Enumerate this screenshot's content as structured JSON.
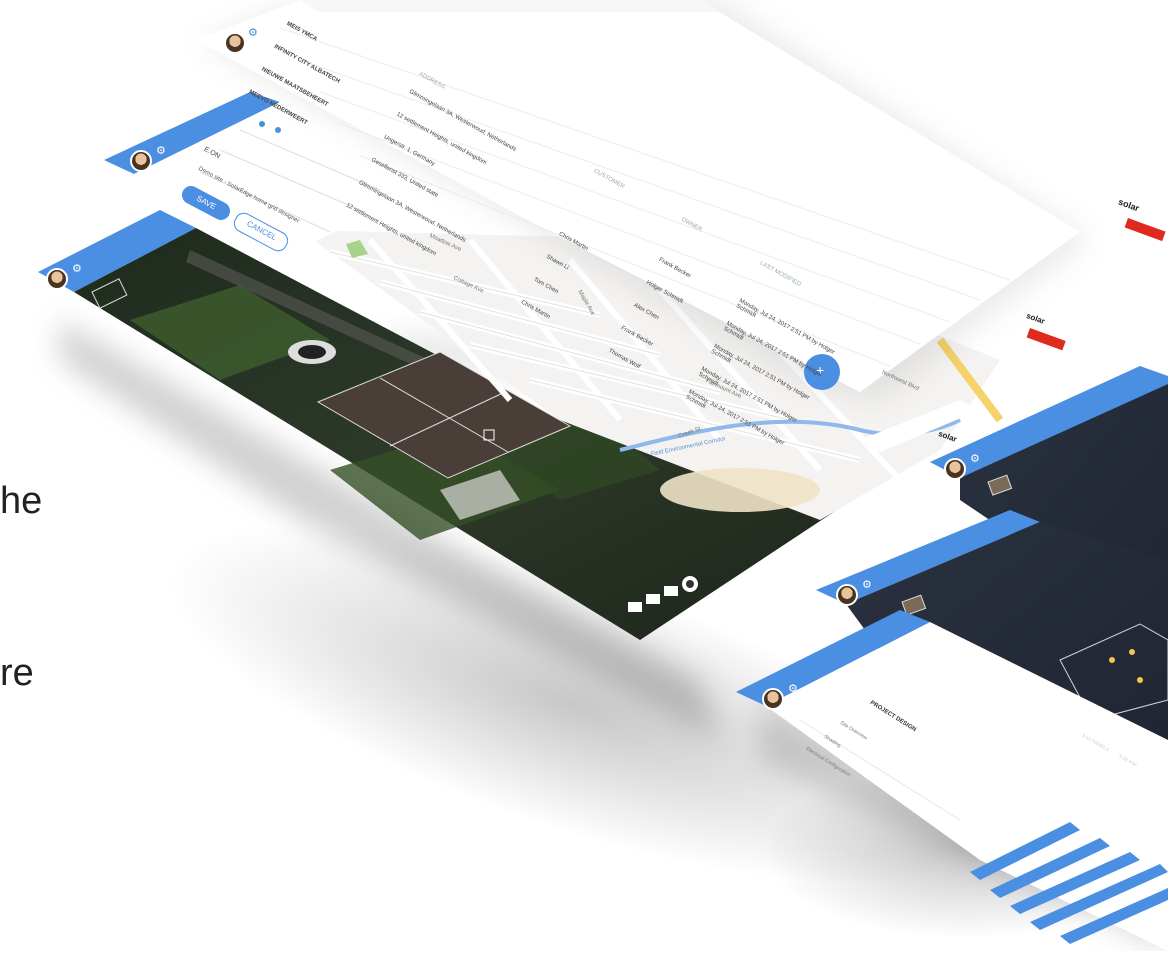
{
  "left_text": [
    "he",
    "re"
  ],
  "brand": {
    "name": "solar",
    "accent": "#e02a20",
    "blue": "#4a8fe2"
  },
  "table_screen": {
    "headers": [
      "",
      "ADDRESS",
      "CUSTOMER",
      "OWNER",
      "LAST MODIFIED"
    ],
    "rows": [
      {
        "name": "MEIS YMCA",
        "address": "Glimmingelaan 3A, Westerwoud, Netherlands",
        "customer": "",
        "owner": "",
        "modified": ""
      },
      {
        "name": "INFINITY CITY ALBATECH",
        "address": "12 settlement Heights, united kingdom",
        "customer": "",
        "owner": "Frank Becker",
        "modified": "Monday, Jul 24, 2017 2:51 PM by Holger Schmidt"
      },
      {
        "name": "NIEUWE MAATSBEHEERT",
        "address": "Ungerstr. 1, Germany",
        "customer": "Chris Martin",
        "owner": "Holger Schmidt",
        "modified": "Monday, Jul 24, 2017 2:51 PM by Holger Schmidt"
      },
      {
        "name": "MEEVO NEDERWEERT",
        "address": "Gesellenst 333, United state",
        "customer": "Shawn Li",
        "owner": "Alex Chen",
        "modified": "Monday, Jul 24, 2017 2:51 PM by Holger Schmidt"
      },
      {
        "name": "",
        "address": "Glimmingelaan 3A, Westerwoud, Netherlands",
        "customer": "Tom Chen",
        "owner": "Frank Becker",
        "modified": "Monday, Jul 24, 2017 2:51 PM by Holger Schmidt"
      },
      {
        "name": "",
        "address": "12 settlement Heights, united kingdom",
        "customer": "Chris Martin",
        "owner": "Thomas Wolf",
        "modified": "Monday, Jul 24, 2017 2:51 PM by Holger Schmidt"
      }
    ],
    "fab": "+"
  },
  "form_panel": {
    "utility_label": "E.ON",
    "tariff_label": "Demo site - SolarEdge home grid designer",
    "save_button": "SAVE",
    "cancel_button": "CANCEL"
  },
  "map": {
    "streets": [
      "Meadow Ave",
      "Cottage Ave",
      "Maple Ave",
      "Creek St",
      "Fairmount Ave",
      "Northwest Blvd"
    ],
    "trail": "Field Environmental Corridor"
  },
  "design_panel": {
    "title": "PROJECT DESIGN",
    "items": [
      "Site Overview",
      "Shading",
      "Electrical Configuration"
    ],
    "labels": [
      "3.54 PANELS",
      "5.32 KW"
    ]
  }
}
